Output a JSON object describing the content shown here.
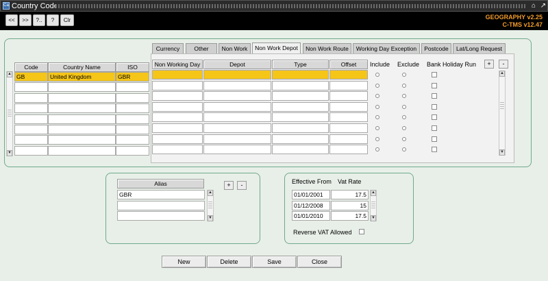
{
  "window": {
    "title": "Country Code",
    "app_icon": "app-icon",
    "restore_glyph": "⌂",
    "maximize_glyph": "↗"
  },
  "toolbar": {
    "buttons": [
      "<<",
      ">>",
      "?..",
      "?",
      "Clr"
    ],
    "version_geography": "GEOGRAPHY v2.25",
    "version_ctms": "C-TMS v12.47",
    "version_color": "#f39c2b"
  },
  "country_grid": {
    "headers": {
      "code": "Code",
      "name": "Country Name",
      "iso": "ISO"
    },
    "rows": [
      {
        "code": "GB",
        "name": "United Kingdom",
        "iso": "GBR",
        "selected": true
      },
      {
        "code": "",
        "name": "",
        "iso": ""
      },
      {
        "code": "",
        "name": "",
        "iso": ""
      },
      {
        "code": "",
        "name": "",
        "iso": ""
      },
      {
        "code": "",
        "name": "",
        "iso": ""
      },
      {
        "code": "",
        "name": "",
        "iso": ""
      },
      {
        "code": "",
        "name": "",
        "iso": ""
      },
      {
        "code": "",
        "name": "",
        "iso": ""
      }
    ]
  },
  "tabs": [
    {
      "label": "Currency"
    },
    {
      "label": "Other"
    },
    {
      "label": "Non Work"
    },
    {
      "label": "Non Work Depot",
      "active": true
    },
    {
      "label": "Non Work Route"
    },
    {
      "label": "Working Day Exception"
    },
    {
      "label": "Postcode"
    },
    {
      "label": "Lat/Long Request"
    }
  ],
  "non_work_depot": {
    "headers": {
      "day": "Non Working Day",
      "depot": "Depot",
      "type": "Type",
      "offset": "Offset",
      "include": "Include",
      "exclude": "Exclude",
      "bank_holiday": "Bank Holiday Run"
    },
    "add_label": "+",
    "remove_label": "-",
    "row_count": 8
  },
  "alias": {
    "header": "Alias",
    "rows": [
      "GBR",
      "",
      ""
    ],
    "add_label": "+",
    "remove_label": "-"
  },
  "vat": {
    "header_from": "Effective From",
    "header_rate": "Vat Rate",
    "rows": [
      {
        "from": "01/01/2001",
        "rate": "17.5"
      },
      {
        "from": "01/12/2008",
        "rate": "15"
      },
      {
        "from": "01/01/2010",
        "rate": "17.5"
      }
    ],
    "reverse_label": "Reverse VAT Allowed"
  },
  "actions": {
    "new": "New",
    "delete": "Delete",
    "save": "Save",
    "close": "Close"
  },
  "colors": {
    "selected_row": "#f5c518",
    "panel_border": "#6fa98a",
    "titlebar": "#2b2b2b"
  }
}
